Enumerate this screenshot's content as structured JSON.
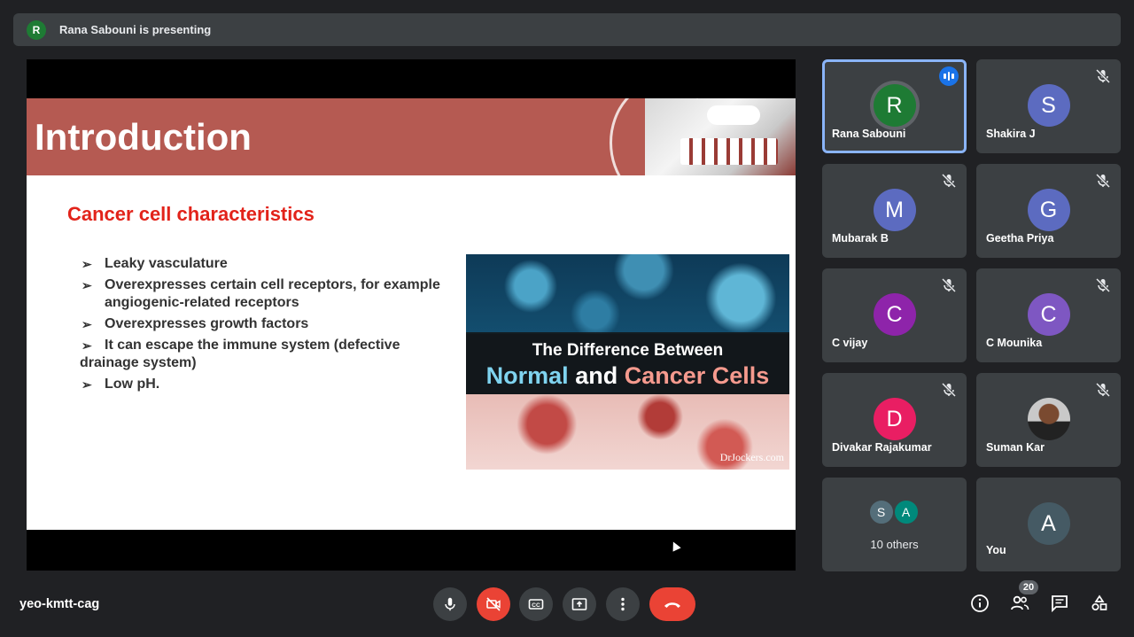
{
  "presenting_bar": {
    "avatar_initial": "R",
    "text": "Rana Sabouni is presenting"
  },
  "slide": {
    "title": "Introduction",
    "subtitle": "Cancer cell characteristics",
    "bullets": [
      "Leaky vasculature",
      "Overexpresses certain cell receptors, for example angiogenic-related receptors",
      "Overexpresses growth factors"
    ],
    "bullet_4_a": "It can escape the immune system (defective",
    "bullet_4_b": "drainage system)",
    "bullet_5": "Low pH.",
    "image": {
      "line1": "The Difference Between",
      "line2_normal": "Normal",
      "line2_and": "and",
      "line2_cancer": "Cancer Cells",
      "brand": "DrJockers.com"
    }
  },
  "participants": [
    {
      "initial": "R",
      "name": "Rana Sabouni",
      "color": "#1e7b34",
      "active": true
    },
    {
      "initial": "S",
      "name": "Shakira J",
      "color": "#5c6bc0",
      "muted": true
    },
    {
      "initial": "M",
      "name": "Mubarak B",
      "color": "#5c6bc0",
      "muted": true
    },
    {
      "initial": "G",
      "name": "Geetha Priya",
      "color": "#5c6bc0",
      "muted": true
    },
    {
      "initial": "C",
      "name": "C vijay",
      "color": "#8e24aa",
      "muted": true
    },
    {
      "initial": "C",
      "name": "C Mounika",
      "color": "#7e57c2",
      "muted": true
    },
    {
      "initial": "D",
      "name": "Divakar Rajakumar",
      "color": "#e91e63",
      "muted": true
    },
    {
      "initial": "",
      "name": "Suman Kar",
      "photo": true,
      "muted": true
    }
  ],
  "others": {
    "avatars": [
      {
        "initial": "S",
        "color": "#546e7a"
      },
      {
        "initial": "A",
        "color": "#00897b"
      }
    ],
    "label": "10 others"
  },
  "self_tile": {
    "initial": "A",
    "name": "You",
    "color": "#455a64"
  },
  "bottom_bar": {
    "meeting_code": "yeo-kmtt-cag",
    "participant_count": "20"
  },
  "icons": [
    "mic-icon",
    "camera-off-icon",
    "captions-icon",
    "present-icon",
    "more-icon",
    "hangup-icon",
    "info-icon",
    "people-icon",
    "chat-icon",
    "activities-icon",
    "mic-off-icon"
  ]
}
